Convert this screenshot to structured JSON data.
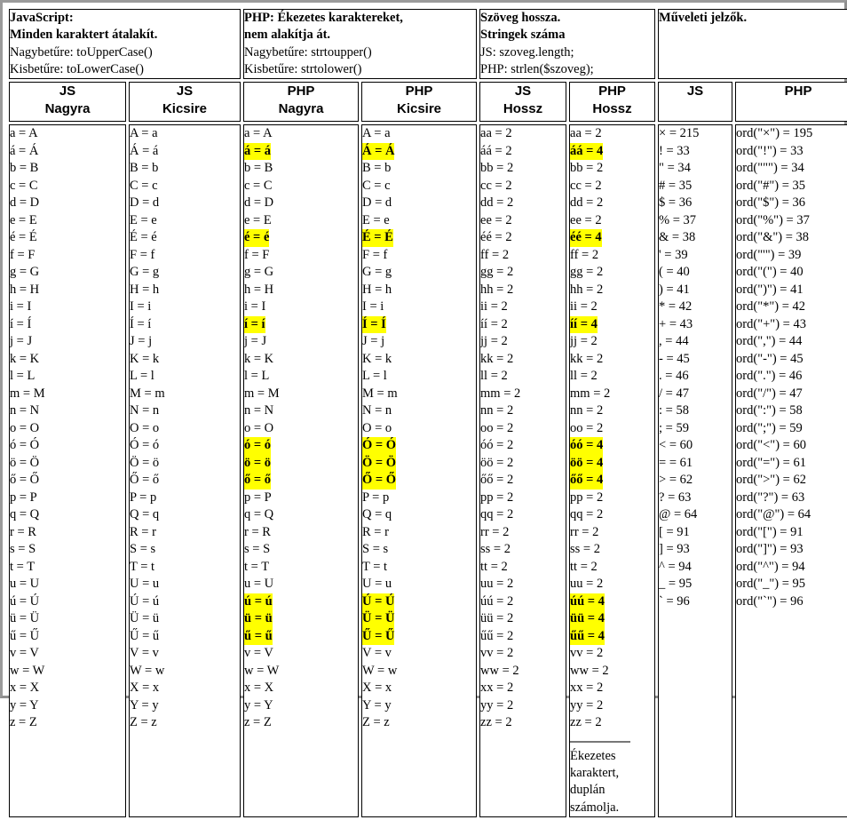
{
  "notes": [
    {
      "id": "js-note",
      "bold_lines": [
        "JavaScript:",
        "Minden karaktert átalakít."
      ],
      "lines": [
        "Nagybetűre: toUpperCase()",
        "Kisbetűre: toLowerCase()"
      ]
    },
    {
      "id": "php-note",
      "bold_lines": [
        "PHP: Ékezetes karaktereket,",
        "nem alakítja át."
      ],
      "lines": [
        "Nagybetűre: strtoupper()",
        "Kisbetűre: strtolower()"
      ]
    },
    {
      "id": "length-note",
      "bold_lines": [
        "Szöveg hossza.",
        "Stringek száma"
      ],
      "lines": [
        "JS: szoveg.length;",
        "PHP: strlen($szoveg);"
      ]
    },
    {
      "id": "operators-note",
      "bold_lines": [
        "Műveleti jelzők."
      ],
      "lines": []
    }
  ],
  "columns": [
    {
      "id": "js-nagyra",
      "head_top": "JS",
      "head_bottom": "Nagyra"
    },
    {
      "id": "js-kicsire",
      "head_top": "JS",
      "head_bottom": "Kicsire"
    },
    {
      "id": "php-nagyra",
      "head_top": "PHP",
      "head_bottom": "Nagyra"
    },
    {
      "id": "php-kicsire",
      "head_top": "PHP",
      "head_bottom": "Kicsire"
    },
    {
      "id": "js-hossz",
      "head_top": "JS",
      "head_bottom": "Hossz"
    },
    {
      "id": "php-hossz",
      "head_top": "PHP",
      "head_bottom": "Hossz"
    },
    {
      "id": "js-ops",
      "head_top": "JS",
      "head_bottom": ""
    },
    {
      "id": "php-ops",
      "head_top": "PHP",
      "head_bottom": ""
    }
  ],
  "cells": {
    "js_nagyra": [
      {
        "t": "a = A"
      },
      {
        "t": "á = Á"
      },
      {
        "t": "b = B"
      },
      {
        "t": "c = C"
      },
      {
        "t": "d = D"
      },
      {
        "t": "e = E"
      },
      {
        "t": "é = É"
      },
      {
        "t": "f = F"
      },
      {
        "t": "g = G"
      },
      {
        "t": "h = H"
      },
      {
        "t": "i = I"
      },
      {
        "t": "í = Í"
      },
      {
        "t": "j = J"
      },
      {
        "t": "k = K"
      },
      {
        "t": "l = L"
      },
      {
        "t": "m = M"
      },
      {
        "t": "n = N"
      },
      {
        "t": "o = O"
      },
      {
        "t": "ó = Ó"
      },
      {
        "t": "ö = Ö"
      },
      {
        "t": "ő = Ő"
      },
      {
        "t": "p = P"
      },
      {
        "t": "q = Q"
      },
      {
        "t": "r = R"
      },
      {
        "t": "s = S"
      },
      {
        "t": "t = T"
      },
      {
        "t": "u = U"
      },
      {
        "t": "ú = Ú"
      },
      {
        "t": "ü = Ü"
      },
      {
        "t": "ű = Ű"
      },
      {
        "t": "v = V"
      },
      {
        "t": "w = W"
      },
      {
        "t": "x = X"
      },
      {
        "t": "y = Y"
      },
      {
        "t": "z = Z"
      }
    ],
    "js_kicsire": [
      {
        "t": "A = a"
      },
      {
        "t": "Á = á"
      },
      {
        "t": "B = b"
      },
      {
        "t": "C = c"
      },
      {
        "t": "D = d"
      },
      {
        "t": "E = e"
      },
      {
        "t": "É = é"
      },
      {
        "t": "F = f"
      },
      {
        "t": "G = g"
      },
      {
        "t": "H = h"
      },
      {
        "t": "I = i"
      },
      {
        "t": "Í = í"
      },
      {
        "t": "J = j"
      },
      {
        "t": "K = k"
      },
      {
        "t": "L = l"
      },
      {
        "t": "M = m"
      },
      {
        "t": "N = n"
      },
      {
        "t": "O = o"
      },
      {
        "t": "Ó = ó"
      },
      {
        "t": "Ö = ö"
      },
      {
        "t": "Ő = ő"
      },
      {
        "t": "P = p"
      },
      {
        "t": "Q = q"
      },
      {
        "t": "R = r"
      },
      {
        "t": "S = s"
      },
      {
        "t": "T = t"
      },
      {
        "t": "U = u"
      },
      {
        "t": "Ú = ú"
      },
      {
        "t": "Ü = ü"
      },
      {
        "t": "Ű = ű"
      },
      {
        "t": "V = v"
      },
      {
        "t": "W = w"
      },
      {
        "t": "X = x"
      },
      {
        "t": "Y = y"
      },
      {
        "t": "Z = z"
      }
    ],
    "php_nagyra": [
      {
        "t": "a = A"
      },
      {
        "t": "á = á",
        "hl": true
      },
      {
        "t": "b = B"
      },
      {
        "t": "c = C"
      },
      {
        "t": "d = D"
      },
      {
        "t": "e = E"
      },
      {
        "t": "é = é",
        "hl": true
      },
      {
        "t": "f = F"
      },
      {
        "t": "g = G"
      },
      {
        "t": "h = H"
      },
      {
        "t": "i = I"
      },
      {
        "t": "í = í",
        "hl": true
      },
      {
        "t": "j = J"
      },
      {
        "t": "k = K"
      },
      {
        "t": "l = L"
      },
      {
        "t": "m = M"
      },
      {
        "t": "n = N"
      },
      {
        "t": "o = O"
      },
      {
        "t": "ó = ó",
        "hl": true
      },
      {
        "t": "ö = ö",
        "hl": true
      },
      {
        "t": "ő = ő",
        "hl": true
      },
      {
        "t": "p = P"
      },
      {
        "t": "q = Q"
      },
      {
        "t": "r = R"
      },
      {
        "t": "s = S"
      },
      {
        "t": "t = T"
      },
      {
        "t": "u = U"
      },
      {
        "t": "ú = ú",
        "hl": true
      },
      {
        "t": "ü = ü",
        "hl": true
      },
      {
        "t": "ű = ű",
        "hl": true
      },
      {
        "t": "v = V"
      },
      {
        "t": "w = W"
      },
      {
        "t": "x = X"
      },
      {
        "t": "y = Y"
      },
      {
        "t": "z = Z"
      }
    ],
    "php_kicsire": [
      {
        "t": "A = a"
      },
      {
        "t": "Á = Á",
        "hl": true
      },
      {
        "t": "B = b"
      },
      {
        "t": "C = c"
      },
      {
        "t": "D = d"
      },
      {
        "t": "E = e"
      },
      {
        "t": "É = É",
        "hl": true
      },
      {
        "t": "F = f"
      },
      {
        "t": "G = g"
      },
      {
        "t": "H = h"
      },
      {
        "t": "I = i"
      },
      {
        "t": "Í = Í",
        "hl": true
      },
      {
        "t": "J = j"
      },
      {
        "t": "K = k"
      },
      {
        "t": "L = l"
      },
      {
        "t": "M = m"
      },
      {
        "t": "N = n"
      },
      {
        "t": "O = o"
      },
      {
        "t": "Ó = Ó",
        "hl": true
      },
      {
        "t": "Ö = Ö",
        "hl": true
      },
      {
        "t": "Ő = Ő",
        "hl": true
      },
      {
        "t": "P = p"
      },
      {
        "t": "Q = q"
      },
      {
        "t": "R = r"
      },
      {
        "t": "S = s"
      },
      {
        "t": "T = t"
      },
      {
        "t": "U = u"
      },
      {
        "t": "Ú = Ú",
        "hl": true
      },
      {
        "t": "Ü = Ü",
        "hl": true
      },
      {
        "t": "Ű = Ű",
        "hl": true
      },
      {
        "t": "V = v"
      },
      {
        "t": "W = w"
      },
      {
        "t": "X = x"
      },
      {
        "t": "Y = y"
      },
      {
        "t": "Z = z"
      }
    ],
    "js_hossz": [
      {
        "t": "aa = 2"
      },
      {
        "t": "áá = 2"
      },
      {
        "t": "bb = 2"
      },
      {
        "t": "cc = 2"
      },
      {
        "t": "dd = 2"
      },
      {
        "t": "ee = 2"
      },
      {
        "t": "éé = 2"
      },
      {
        "t": "ff = 2"
      },
      {
        "t": "gg = 2"
      },
      {
        "t": "hh = 2"
      },
      {
        "t": "ii = 2"
      },
      {
        "t": "íí = 2"
      },
      {
        "t": "jj = 2"
      },
      {
        "t": "kk = 2"
      },
      {
        "t": "ll = 2"
      },
      {
        "t": "mm = 2"
      },
      {
        "t": "nn = 2"
      },
      {
        "t": "oo = 2"
      },
      {
        "t": "óó = 2"
      },
      {
        "t": "öö = 2"
      },
      {
        "t": "őő = 2"
      },
      {
        "t": "pp = 2"
      },
      {
        "t": "qq = 2"
      },
      {
        "t": "rr = 2"
      },
      {
        "t": "ss = 2"
      },
      {
        "t": "tt = 2"
      },
      {
        "t": "uu = 2"
      },
      {
        "t": "úú = 2"
      },
      {
        "t": "üü = 2"
      },
      {
        "t": "űű = 2"
      },
      {
        "t": "vv = 2"
      },
      {
        "t": "ww = 2"
      },
      {
        "t": "xx = 2"
      },
      {
        "t": "yy = 2"
      },
      {
        "t": "zz = 2"
      }
    ],
    "php_hossz": [
      {
        "t": "aa = 2"
      },
      {
        "t": "áá = 4",
        "hl": true
      },
      {
        "t": "bb = 2"
      },
      {
        "t": "cc = 2"
      },
      {
        "t": "dd = 2"
      },
      {
        "t": "ee = 2"
      },
      {
        "t": "éé = 4",
        "hl": true
      },
      {
        "t": "ff = 2"
      },
      {
        "t": "gg = 2"
      },
      {
        "t": "hh = 2"
      },
      {
        "t": "ii = 2"
      },
      {
        "t": "íí = 4",
        "hl": true
      },
      {
        "t": "jj = 2"
      },
      {
        "t": "kk = 2"
      },
      {
        "t": "ll = 2"
      },
      {
        "t": "mm = 2"
      },
      {
        "t": "nn = 2"
      },
      {
        "t": "oo = 2"
      },
      {
        "t": "óó = 4",
        "hl": true
      },
      {
        "t": "öö = 4",
        "hl": true
      },
      {
        "t": "őő = 4",
        "hl": true
      },
      {
        "t": "pp = 2"
      },
      {
        "t": "qq = 2"
      },
      {
        "t": "rr = 2"
      },
      {
        "t": "ss = 2"
      },
      {
        "t": "tt = 2"
      },
      {
        "t": "uu = 2"
      },
      {
        "t": "úú = 4",
        "hl": true
      },
      {
        "t": "üü = 4",
        "hl": true
      },
      {
        "t": "űű = 4",
        "hl": true
      },
      {
        "t": "vv = 2"
      },
      {
        "t": "ww = 2"
      },
      {
        "t": "xx = 2"
      },
      {
        "t": "yy = 2"
      },
      {
        "t": "zz = 2"
      }
    ],
    "js_ops": [
      {
        "t": "× = 215"
      },
      {
        "t": "! = 33"
      },
      {
        "t": "\" = 34"
      },
      {
        "t": "# = 35"
      },
      {
        "t": "$ = 36"
      },
      {
        "t": "% = 37"
      },
      {
        "t": "& = 38"
      },
      {
        "t": "' = 39"
      },
      {
        "t": "( = 40"
      },
      {
        "t": ") = 41"
      },
      {
        "t": "* = 42"
      },
      {
        "t": "+ = 43"
      },
      {
        "t": ", = 44"
      },
      {
        "t": "- = 45"
      },
      {
        "t": ". = 46"
      },
      {
        "t": "/ = 47"
      },
      {
        "t": ": = 58"
      },
      {
        "t": "; = 59"
      },
      {
        "t": "< = 60"
      },
      {
        "t": "= = 61"
      },
      {
        "t": "> = 62"
      },
      {
        "t": "? = 63"
      },
      {
        "t": "@ = 64"
      },
      {
        "t": "[ = 91"
      },
      {
        "t": "] = 93"
      },
      {
        "t": "^ = 94"
      },
      {
        "t": "_ = 95"
      },
      {
        "t": "` = 96"
      }
    ],
    "php_ops": [
      {
        "t": "ord(\"×\") = 195"
      },
      {
        "t": "ord(\"!\") = 33"
      },
      {
        "t": "ord(\"\"\") = 34"
      },
      {
        "t": "ord(\"#\") = 35"
      },
      {
        "t": "ord(\"$\") = 36"
      },
      {
        "t": "ord(\"%\") = 37"
      },
      {
        "t": "ord(\"&\") = 38"
      },
      {
        "t": "ord(\"'\") = 39"
      },
      {
        "t": "ord(\"(\") = 40"
      },
      {
        "t": "ord(\")\") = 41"
      },
      {
        "t": "ord(\"*\") = 42"
      },
      {
        "t": "ord(\"+\") = 43"
      },
      {
        "t": "ord(\",\") = 44"
      },
      {
        "t": "ord(\"-\") = 45"
      },
      {
        "t": "ord(\".\") = 46"
      },
      {
        "t": "ord(\"/\") = 47"
      },
      {
        "t": "ord(\":\") = 58"
      },
      {
        "t": "ord(\";\") = 59"
      },
      {
        "t": "ord(\"<\") = 60"
      },
      {
        "t": "ord(\"=\") = 61"
      },
      {
        "t": "ord(\">\") = 62"
      },
      {
        "t": "ord(\"?\") = 63"
      },
      {
        "t": "ord(\"@\") = 64"
      },
      {
        "t": "ord(\"[\") = 91"
      },
      {
        "t": "ord(\"]\") = 93"
      },
      {
        "t": "ord(\"^\") = 94"
      },
      {
        "t": "ord(\"_\") = 95"
      },
      {
        "t": "ord(\"`\") = 96"
      }
    ]
  },
  "footnote": {
    "lines": [
      "Ékezetes",
      "karaktert,",
      "duplán",
      "számolja."
    ]
  },
  "colors": {
    "highlight": "#ffff00",
    "frame": "#9a9a9a",
    "border": "#000000",
    "background": "#ffffff"
  }
}
